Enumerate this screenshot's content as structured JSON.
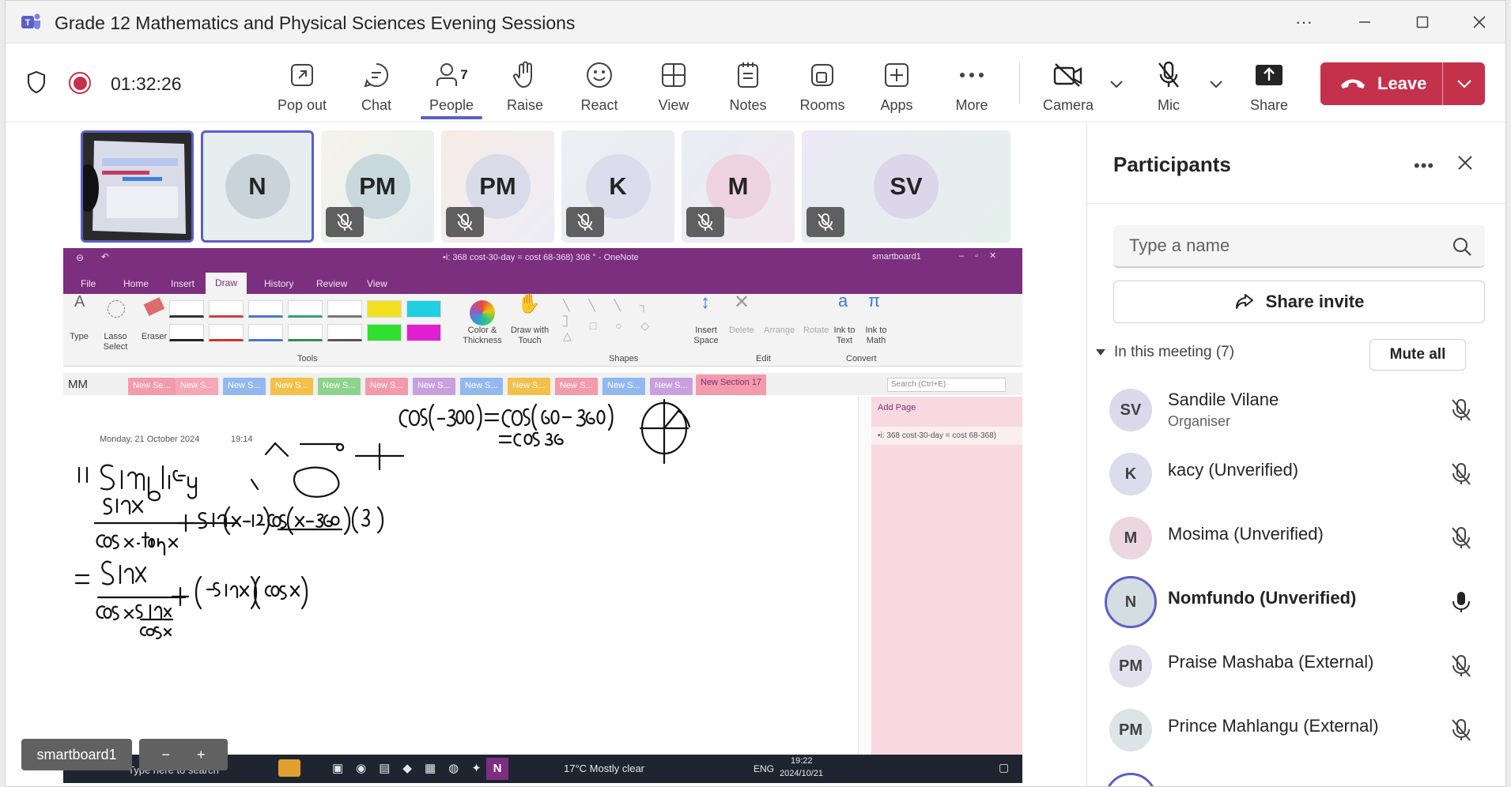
{
  "window": {
    "title": "Grade 12 Mathematics and Physical Sciences Evening Sessions"
  },
  "meeting": {
    "timer": "01:32:26"
  },
  "toolbar": {
    "pop_out": "Pop out",
    "chat": "Chat",
    "people": "People",
    "people_count": "7",
    "raise": "Raise",
    "react": "React",
    "view": "View",
    "notes": "Notes",
    "rooms": "Rooms",
    "apps": "Apps",
    "more": "More",
    "camera": "Camera",
    "mic": "Mic",
    "share": "Share",
    "leave": "Leave"
  },
  "gallery": [
    {
      "initials": "N"
    },
    {
      "initials": "PM"
    },
    {
      "initials": "PM"
    },
    {
      "initials": "K"
    },
    {
      "initials": "M"
    },
    {
      "initials": "SV"
    }
  ],
  "shared_screen": {
    "window_title": "•i: 368 cost-30-day = cost 68-368) 308 ° - OneNote",
    "account": "smartboard1",
    "tabs": [
      "File",
      "Home",
      "Insert",
      "Draw",
      "History",
      "Review",
      "View"
    ],
    "ribbon": {
      "type": "Type",
      "lasso": "Lasso Select",
      "eraser": "Eraser",
      "tools": "Tools",
      "color": "Color & Thickness",
      "draw_touch": "Draw with Touch",
      "shapes": "Shapes",
      "insert_space": "Insert Space",
      "delete": "Delete",
      "arrange": "Arrange",
      "rotate": "Rotate",
      "edit": "Edit",
      "ink_text": "Ink to Text",
      "ink_math": "Ink to Math",
      "convert": "Convert"
    },
    "notebook": "MM",
    "sections": [
      "New Se...",
      "New S...",
      "New S...",
      "New S...",
      "New S...",
      "New S...",
      "New S...",
      "New S...",
      "New S...",
      "New S...",
      "New S...",
      "New S..."
    ],
    "active_section": "New Section 17",
    "search_placeholder": "Search (Ctrl+E)",
    "add_page": "Add Page",
    "page_entry": "•i: 368 cost-30-day = cost 68-368)",
    "date": "Monday, 21 October 2024",
    "time": "19:14",
    "taskbar": {
      "search": "Type here to search",
      "weather": "17°C  Mostly clear",
      "lang": "ENG",
      "clock": "19:22",
      "date": "2024/10/21"
    }
  },
  "presenter_label": "smartboard1",
  "panel": {
    "title": "Participants",
    "search_placeholder": "Type a name",
    "share_invite": "Share invite",
    "section": "In this meeting (7)",
    "mute_all": "Mute all",
    "people": [
      {
        "initials": "SV",
        "name": "Sandile Vilane",
        "role": "Organiser",
        "mic": "muted"
      },
      {
        "initials": "K",
        "name": "kacy (Unverified)",
        "role": "",
        "mic": "muted"
      },
      {
        "initials": "M",
        "name": "Mosima (Unverified)",
        "role": "",
        "mic": "muted"
      },
      {
        "initials": "N",
        "name": "Nomfundo (Unverified)",
        "role": "",
        "mic": "on"
      },
      {
        "initials": "PM",
        "name": "Praise Mashaba (External)",
        "role": "",
        "mic": "muted"
      },
      {
        "initials": "PM",
        "name": "Prince Mahlangu (External)",
        "role": "",
        "mic": "muted"
      }
    ]
  },
  "colors": {
    "accent": "#5b5fc7",
    "leave": "#c4314b",
    "onenote": "#7b2f7e"
  }
}
